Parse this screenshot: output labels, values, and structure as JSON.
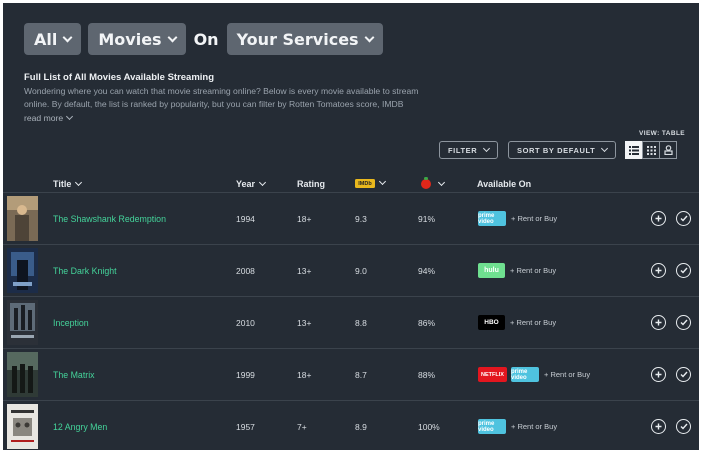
{
  "filters": {
    "type_label": "All",
    "category_label": "Movies",
    "connector": "On",
    "services_label": "Your Services"
  },
  "intro": {
    "title": "Full List of All Movies Available Streaming",
    "description": "Wondering where you can watch that movie streaming online? Below is every movie available to stream online. By default, the list is ranked by popularity, but you can filter by Rotten Tomatoes score, IMDB",
    "read_more": "read more"
  },
  "controls": {
    "filter_label": "FILTER",
    "sort_label": "SORT BY DEFAULT",
    "view_label": "VIEW: TABLE"
  },
  "columns": {
    "title": "Title",
    "year": "Year",
    "rating": "Rating",
    "imdb": "IMDb",
    "available": "Available On"
  },
  "services": {
    "amazon": "prime video",
    "hulu": "hulu",
    "hbo": "HBO",
    "netflix": "NETFLIX"
  },
  "colors": {
    "background": "#252c35",
    "title_link": "#44d39a",
    "imdb": "#e9b81d",
    "tomato": "#e0271a"
  },
  "movies": [
    {
      "title": "The Shawshank Redemption",
      "year": "1994",
      "rating": "18+",
      "imdb": "9.3",
      "rt": "91%",
      "services": [
        "amazon"
      ],
      "rent_label": "+ Rent or Buy"
    },
    {
      "title": "The Dark Knight",
      "year": "2008",
      "rating": "13+",
      "imdb": "9.0",
      "rt": "94%",
      "services": [
        "hulu"
      ],
      "rent_label": "+ Rent or Buy"
    },
    {
      "title": "Inception",
      "year": "2010",
      "rating": "13+",
      "imdb": "8.8",
      "rt": "86%",
      "services": [
        "hbo"
      ],
      "rent_label": "+ Rent or Buy"
    },
    {
      "title": "The Matrix",
      "year": "1999",
      "rating": "18+",
      "imdb": "8.7",
      "rt": "88%",
      "services": [
        "netflix",
        "amazon"
      ],
      "rent_label": "+ Rent or Buy"
    },
    {
      "title": "12 Angry Men",
      "year": "1957",
      "rating": "7+",
      "imdb": "8.9",
      "rt": "100%",
      "services": [
        "amazon"
      ],
      "rent_label": "+ Rent or Buy"
    }
  ]
}
